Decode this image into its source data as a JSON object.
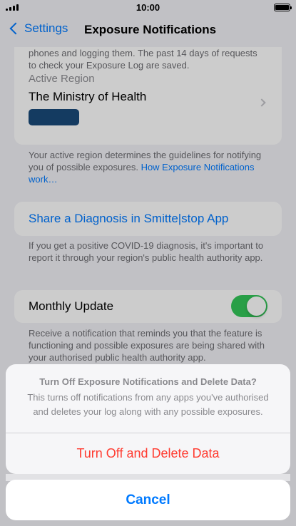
{
  "status_bar": {
    "time": "10:00"
  },
  "nav": {
    "back_label": "Settings",
    "title": "Exposure Notifications"
  },
  "log_note": {
    "text": "phones and logging them. The past 14 days of requests to check your Exposure Log are saved."
  },
  "region": {
    "label": "Active Region",
    "value": "The Ministry of Health",
    "logo_color": "#1a4a7a",
    "footnote": "Your active region determines the guidelines for notifying you of possible exposures.",
    "footnote_link": "How Exposure Notifications work…"
  },
  "share": {
    "label": "Share a Diagnosis in Smitte|stop App",
    "footnote": "If you get a positive COVID-19 diagnosis, it's important to report it through your region's public health authority app."
  },
  "monthly_update": {
    "label": "Monthly Update",
    "enabled": true,
    "footnote": "Receive a notification that reminds you that the feature is functioning and possible exposures are being shared with your authorised public health authority app."
  },
  "action_sheet": {
    "title": "Turn Off Exposure Notifications and Delete Data?",
    "message": "This turns off notifications from any apps you've authorised and deletes your log along with any possible exposures.",
    "destructive_label": "Turn Off and Delete Data",
    "cancel_label": "Cancel"
  },
  "colors": {
    "accent": "#007aff",
    "destructive": "#ff3b30",
    "toggle_on": "#34c759",
    "background": "#f2f2f7"
  }
}
